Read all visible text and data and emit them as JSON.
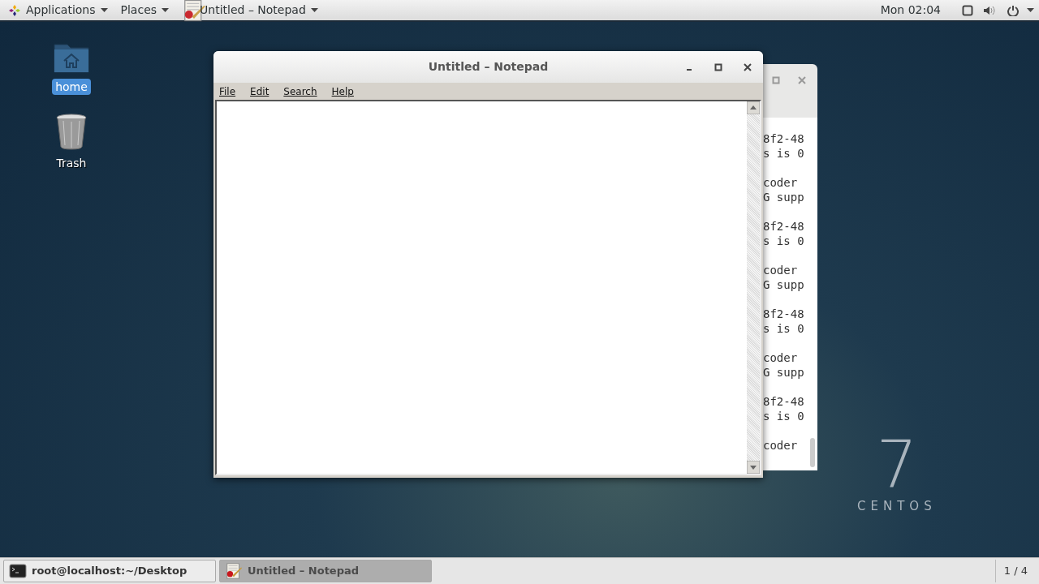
{
  "top_bar": {
    "menus": [
      {
        "kind": "applications",
        "label": "Applications"
      },
      {
        "kind": "places",
        "label": "Places"
      },
      {
        "kind": "app",
        "label": "Untitled – Notepad"
      }
    ],
    "clock": "Mon 02:04"
  },
  "desktop_icons": [
    {
      "kind": "folder",
      "label": "home",
      "selected": true
    },
    {
      "kind": "trash",
      "label": "Trash",
      "selected": false
    }
  ],
  "terminal_window": {
    "blocks": [
      [
        "8f2-48",
        "s is 0"
      ],
      [
        "coder",
        "G supp"
      ],
      [
        "8f2-48",
        "s is 0"
      ],
      [
        "coder",
        "G supp"
      ],
      [
        "8f2-48",
        "s is 0"
      ],
      [
        "coder",
        "G supp"
      ],
      [
        "8f2-48",
        "s is 0"
      ],
      [
        "coder"
      ]
    ]
  },
  "notepad_window": {
    "title": "Untitled – Notepad",
    "menu": [
      "File",
      "Edit",
      "Search",
      "Help"
    ]
  },
  "wallpaper_logo": {
    "number": "7",
    "word": "CENTOS"
  },
  "taskbar": {
    "items": [
      {
        "kind": "terminal",
        "label": "root@localhost:~/Desktop",
        "selected": false
      },
      {
        "kind": "notepad",
        "label": "Untitled – Notepad",
        "selected": true
      }
    ],
    "pager": "1 / 4"
  }
}
